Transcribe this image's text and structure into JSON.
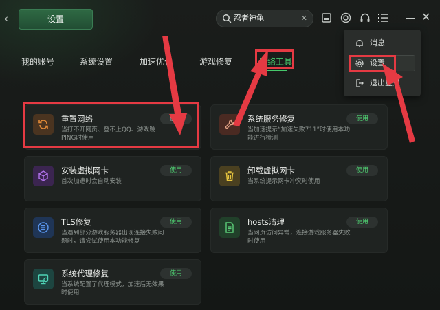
{
  "window": {
    "title": "设置",
    "back_icon": "chevron-left-icon"
  },
  "search": {
    "value": "忍者神龟",
    "clear": "✕"
  },
  "toolbar": {
    "icons": [
      "screen-icon",
      "target-icon",
      "headset-icon",
      "menu-list-icon",
      "minimize-icon",
      "close-icon"
    ]
  },
  "menu": {
    "items": [
      {
        "label": "消息",
        "icon": "bell-icon"
      },
      {
        "label": "设置",
        "icon": "gear-icon",
        "selected": true
      },
      {
        "label": "退出登录",
        "icon": "logout-icon"
      }
    ]
  },
  "tabs": [
    {
      "label": "我的账号"
    },
    {
      "label": "系统设置"
    },
    {
      "label": "加速优化"
    },
    {
      "label": "游戏修复"
    },
    {
      "label": "网络工具",
      "active": true
    }
  ],
  "cards": [
    {
      "title": "重置网络",
      "desc": "当打不开网页、登不上QQ、游戏跳PING时使用",
      "button": "使用",
      "icon": "refresh-icon",
      "icon_color": "#c9742e"
    },
    {
      "title": "系统服务修复",
      "desc": "当加速提示“加速失败711”时使用本功能进行检测",
      "button": "使用",
      "icon": "wrench-icon",
      "icon_color": "#d08a62"
    },
    {
      "title": "安装虚拟网卡",
      "desc": "首次加速时会自动安装",
      "button": "使用",
      "icon": "cube-icon",
      "icon_color": "#9a5ad0"
    },
    {
      "title": "卸载虚拟网卡",
      "desc": "当系统提示网卡冲突时使用",
      "button": "使用",
      "icon": "trash-icon",
      "icon_color": "#d3b43a"
    },
    {
      "title": "TLS修复",
      "desc": "当遇到部分游戏服务器出现连接失败问题时，请尝试使用本功能修复",
      "button": "使用",
      "icon": "list-icon",
      "icon_color": "#3f7fdc"
    },
    {
      "title": "hosts清理",
      "desc": "当网页访问异常，连接游戏服务器失败时使用",
      "button": "使用",
      "icon": "document-icon",
      "icon_color": "#4fb86a"
    },
    {
      "title": "系统代理修复",
      "desc": "当系统配置了代理模式，加速后无效果时使用",
      "button": "使用",
      "icon": "monitor-icon",
      "icon_color": "#35b49b"
    }
  ],
  "colors": {
    "accent": "#46c86b",
    "annotation": "#e53a43",
    "background": "#151816",
    "card": "#1f2321"
  }
}
